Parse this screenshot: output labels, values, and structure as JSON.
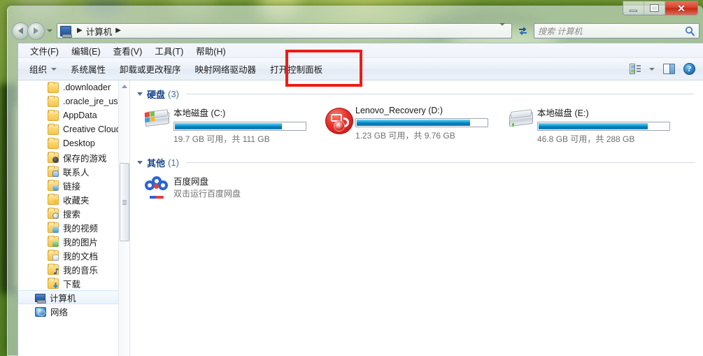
{
  "window": {
    "titlebar": {
      "minimize_label": "–",
      "maximize_label": "",
      "close_label": "✕"
    }
  },
  "navigation": {
    "back_tooltip": "后退",
    "forward_tooltip": "前进",
    "history_tooltip": "最近的位置",
    "refresh_tooltip": "刷新",
    "breadcrumb": [
      {
        "label": "计算机"
      }
    ],
    "breadcrumb_separator": "▶"
  },
  "search": {
    "placeholder": "搜索 计算机",
    "value": ""
  },
  "menubar": {
    "items": [
      {
        "label": "文件(F)"
      },
      {
        "label": "编辑(E)"
      },
      {
        "label": "查看(V)"
      },
      {
        "label": "工具(T)"
      },
      {
        "label": "帮助(H)"
      }
    ]
  },
  "toolbar": {
    "organize_label": "组织",
    "organize_caret": "▾",
    "items": [
      {
        "label": "系统属性"
      },
      {
        "label": "卸载或更改程序"
      },
      {
        "label": "映射网络驱动器"
      },
      {
        "label": "打开控制面板"
      }
    ],
    "view_tooltip": "更改视图",
    "preview_tooltip": "显示预览窗格",
    "help_tooltip": "获取帮助",
    "help_glyph": "?"
  },
  "navpane": {
    "items": [
      {
        "label": ".downloader",
        "icon": "folder-icon",
        "badge": ""
      },
      {
        "label": ".oracle_jre_usa",
        "icon": "folder-icon",
        "badge": ""
      },
      {
        "label": "AppData",
        "icon": "folder-icon",
        "badge": ""
      },
      {
        "label": "Creative Cloud",
        "icon": "folder-icon",
        "badge": ""
      },
      {
        "label": "Desktop",
        "icon": "folder-icon",
        "badge": ""
      },
      {
        "label": "保存的游戏",
        "icon": "folder-icon",
        "badge": "badge-game"
      },
      {
        "label": "联系人",
        "icon": "folder-icon",
        "badge": "badge-contact"
      },
      {
        "label": "链接",
        "icon": "folder-icon",
        "badge": "badge-link"
      },
      {
        "label": "收藏夹",
        "icon": "folder-icon",
        "badge": "badge-fav"
      },
      {
        "label": "搜索",
        "icon": "folder-icon",
        "badge": "badge-search"
      },
      {
        "label": "我的视频",
        "icon": "folder-icon",
        "badge": "badge-video"
      },
      {
        "label": "我的图片",
        "icon": "folder-icon",
        "badge": "badge-pic"
      },
      {
        "label": "我的文档",
        "icon": "folder-icon",
        "badge": "badge-doc"
      },
      {
        "label": "我的音乐",
        "icon": "folder-icon",
        "badge": "badge-music"
      },
      {
        "label": "下载",
        "icon": "folder-icon",
        "badge": "badge-down"
      }
    ],
    "roots": [
      {
        "label": "计算机",
        "icon": "computer-icon",
        "selected": true
      },
      {
        "label": "网络",
        "icon": "network-icon",
        "selected": false
      }
    ]
  },
  "content": {
    "groups": [
      {
        "title": "硬盘",
        "count": "(3)",
        "kind": "drives",
        "items": [
          {
            "name": "本地磁盘 (C:)",
            "icon": "system-drive-icon",
            "free_total": "19.7 GB 可用，共 111 GB",
            "free_gb": 19.7,
            "total_gb": 111,
            "used_percent": 82
          },
          {
            "name": "Lenovo_Recovery (D:)",
            "icon": "recovery-drive-icon",
            "free_total": "1.23 GB 可用，共 9.76 GB",
            "free_gb": 1.23,
            "total_gb": 9.76,
            "used_percent": 87
          },
          {
            "name": "本地磁盘 (E:)",
            "icon": "drive-icon",
            "free_total": "46.8 GB 可用，共 288 GB",
            "free_gb": 46.8,
            "total_gb": 288,
            "used_percent": 84
          }
        ]
      },
      {
        "title": "其他",
        "count": "(1)",
        "kind": "other",
        "items": [
          {
            "name": "百度网盘",
            "icon": "baidu-netdisk-icon",
            "free_total": "双击运行百度网盘"
          }
        ]
      }
    ]
  },
  "annotation": {
    "highlight_target": "打开控制面板",
    "color": "#ee1c16"
  }
}
